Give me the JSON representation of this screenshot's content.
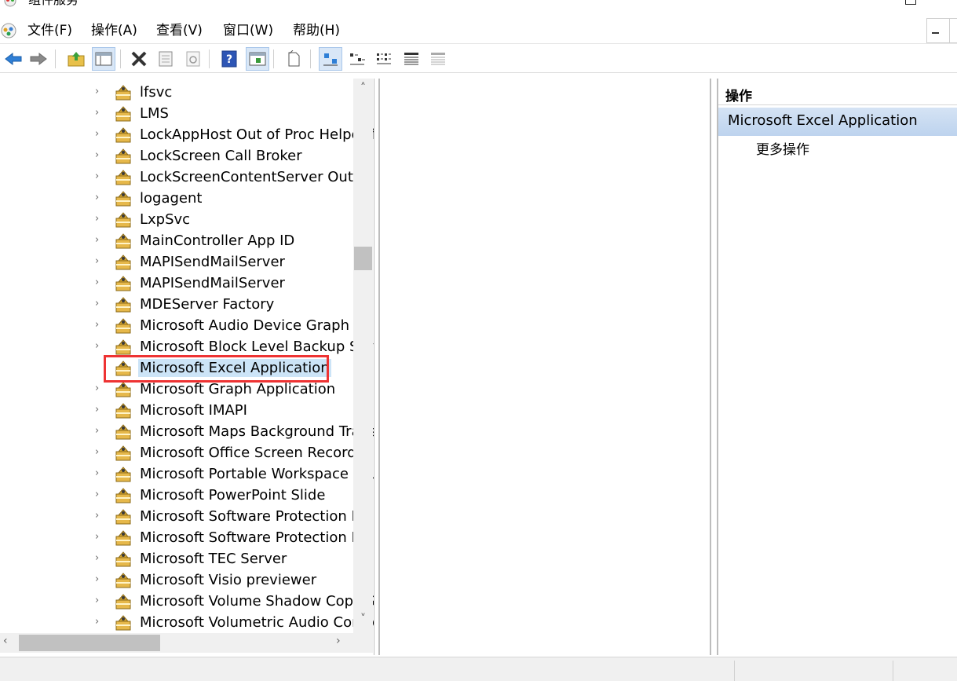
{
  "window": {
    "title": "组件服务"
  },
  "menu": [
    "文件(F)",
    "操作(A)",
    "查看(V)",
    "窗口(W)",
    "帮助(H)"
  ],
  "toolbar": {
    "buttons": [
      "back-icon",
      "forward-icon",
      "up-folder-icon",
      "show-hide-tree-icon",
      "delete-icon",
      "properties-icon",
      "refresh-icon",
      "help-icon",
      "show-action-pane-icon",
      "new-icon",
      "large-icons-view-icon",
      "small-icons-view-icon",
      "list-view-icon",
      "detail-view-icon",
      "status-view-icon"
    ]
  },
  "tree": {
    "items": [
      {
        "label": "lfsvc"
      },
      {
        "label": "LMS"
      },
      {
        "label": "LockAppHost Out of Proc Helper f"
      },
      {
        "label": "LockScreen Call Broker"
      },
      {
        "label": "LockScreenContentServer Out of"
      },
      {
        "label": "logagent"
      },
      {
        "label": "LxpSvc"
      },
      {
        "label": "MainController App ID"
      },
      {
        "label": "MAPISendMailServer"
      },
      {
        "label": "MAPISendMailServer"
      },
      {
        "label": "MDEServer Factory"
      },
      {
        "label": "Microsoft Audio Device Graph Se"
      },
      {
        "label": "Microsoft Block Level Backup Serv"
      },
      {
        "label": "Microsoft Excel Application"
      },
      {
        "label": "Microsoft Graph Application"
      },
      {
        "label": "Microsoft IMAPI"
      },
      {
        "label": "Microsoft Maps Background Trans"
      },
      {
        "label": "Microsoft Office Screen Recorder"
      },
      {
        "label": "Microsoft Portable Workspace Lau"
      },
      {
        "label": "Microsoft PowerPoint Slide"
      },
      {
        "label": "Microsoft Software Protection Pla"
      },
      {
        "label": "Microsoft Software Protection Pla"
      },
      {
        "label": "Microsoft TEC Server"
      },
      {
        "label": "Microsoft Visio previewer"
      },
      {
        "label": "Microsoft Volume Shadow Copy S"
      },
      {
        "label": "Microsoft Volumetric Audio Comp"
      }
    ],
    "selected_index": 13
  },
  "actions": {
    "header": "操作",
    "section_title": "Microsoft Excel Application",
    "more_actions": "更多操作"
  },
  "colors": {
    "selection": "#cce4f7",
    "highlight_box": "#ee3333",
    "action_section": "#c6d9f0"
  }
}
